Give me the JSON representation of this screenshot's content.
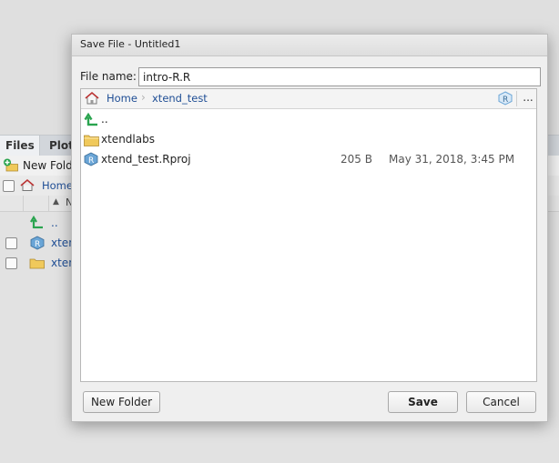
{
  "background": {
    "tabs": [
      "Files",
      "Plot"
    ],
    "toolbar_new_folder": "New Folde",
    "crumb_home": "Home",
    "header_name": "N",
    "rows": [
      {
        "name": ".."
      },
      {
        "name": "xten"
      },
      {
        "name": "xten"
      }
    ]
  },
  "dialog": {
    "title": "Save File - Untitled1",
    "file_name_label": "File name:",
    "file_name_value": "intro-R.R",
    "breadcrumb": {
      "home": "Home",
      "folder": "xtend_test",
      "more": "..."
    },
    "files": [
      {
        "name": "..",
        "icon": "up-arrow-icon",
        "size": "",
        "modified": ""
      },
      {
        "name": "xtendlabs",
        "icon": "folder-icon",
        "size": "",
        "modified": ""
      },
      {
        "name": "xtend_test.Rproj",
        "icon": "rproj-icon",
        "size": "205 B",
        "modified": "May 31, 2018, 3:45 PM"
      }
    ],
    "buttons": {
      "new_folder": "New Folder",
      "save": "Save",
      "cancel": "Cancel"
    }
  },
  "colors": {
    "link": "#1f4e95",
    "up_arrow": "#2aa44f",
    "folder": "#f0c95b",
    "rproj": "#6aa5d6"
  }
}
